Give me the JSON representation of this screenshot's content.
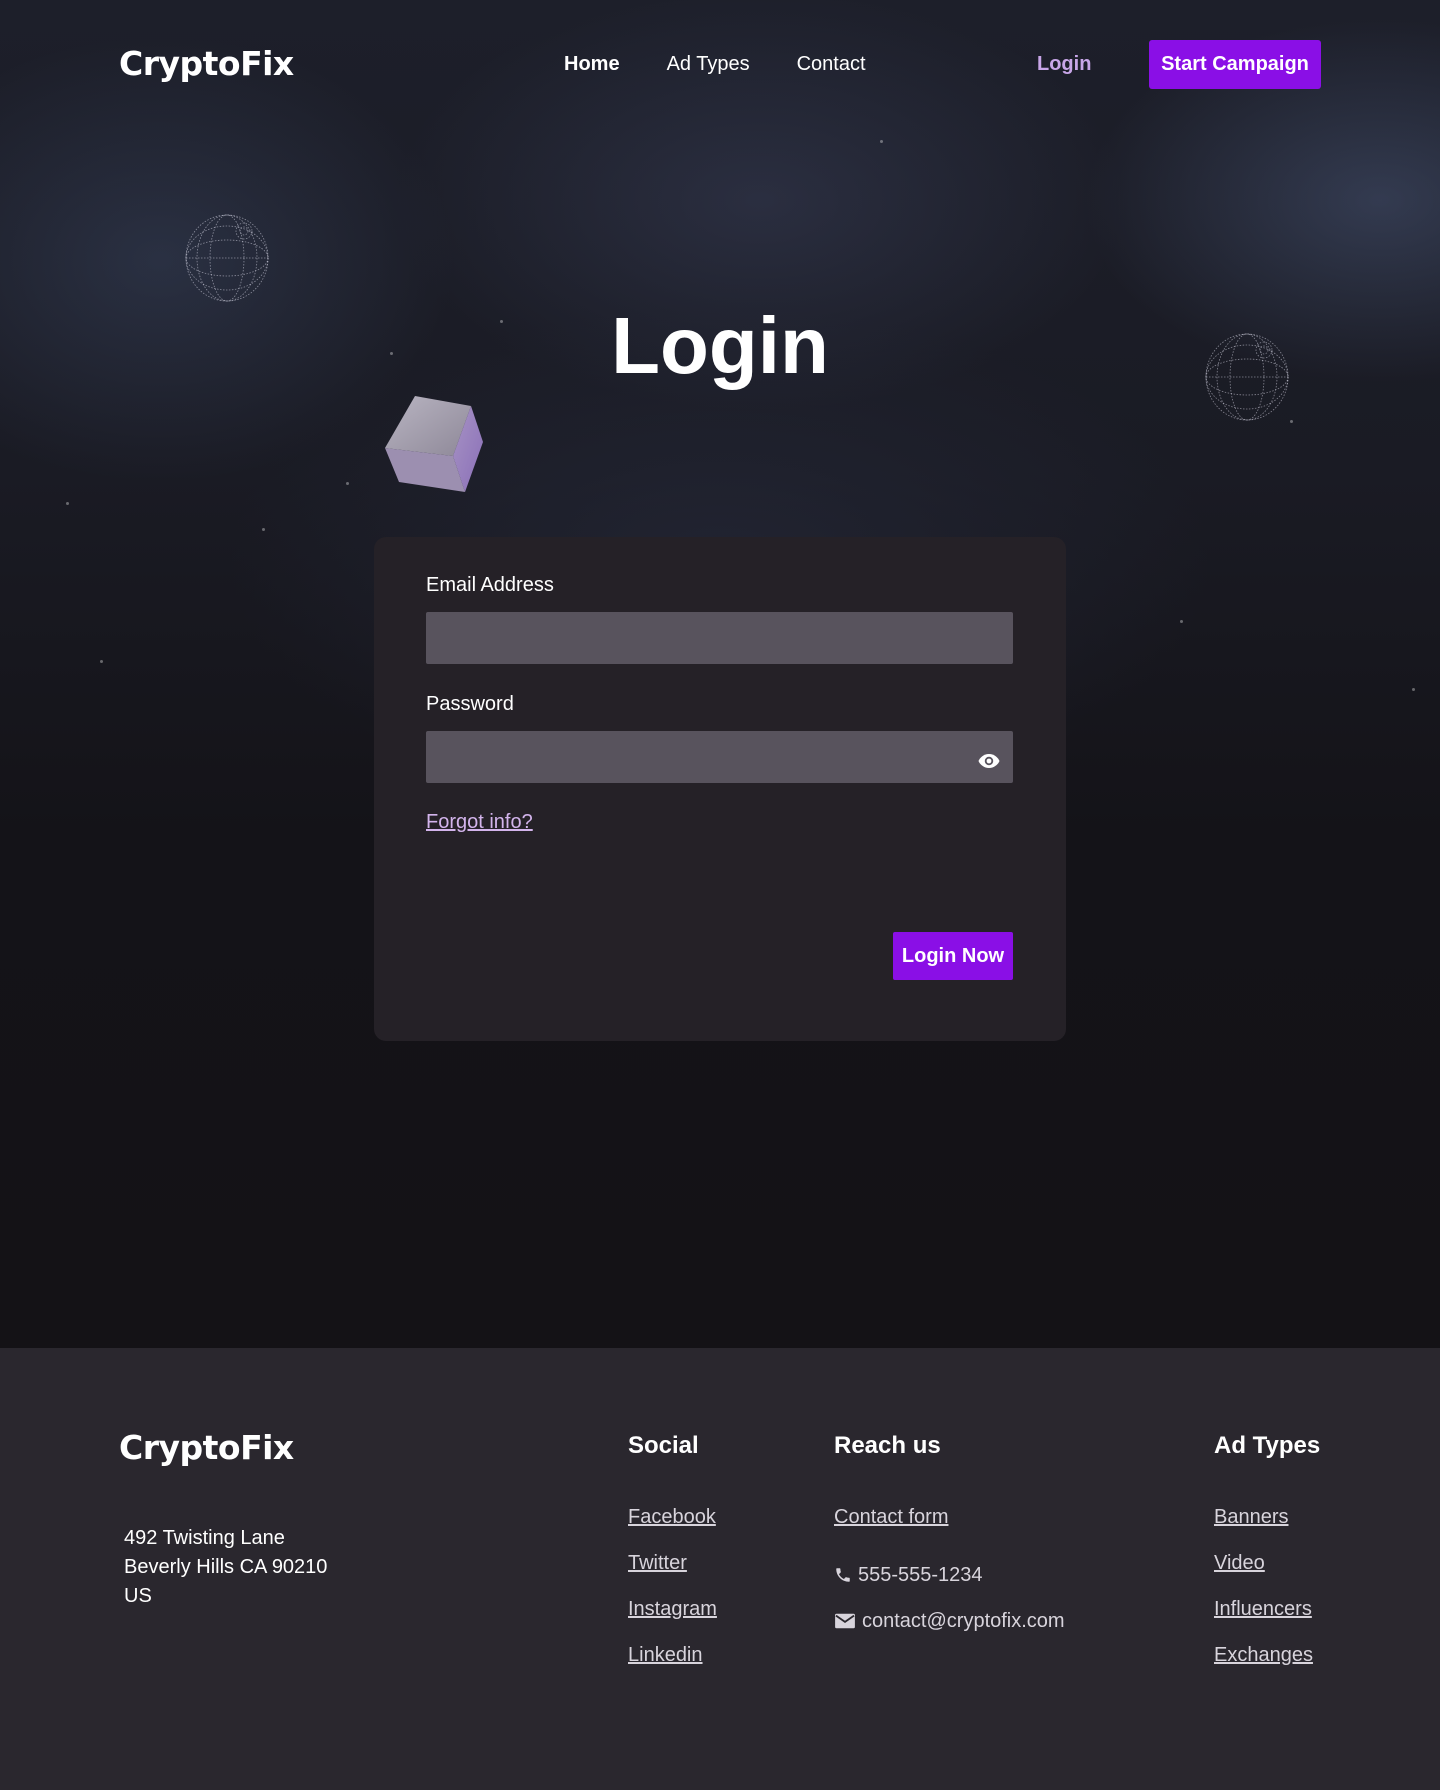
{
  "brand": {
    "name": "CryptoFix"
  },
  "nav": {
    "items": [
      {
        "label": "Home",
        "active": true
      },
      {
        "label": "Ad Types",
        "active": false
      },
      {
        "label": "Contact",
        "active": false
      }
    ],
    "login_label": "Login",
    "cta_label": "Start Campaign"
  },
  "page": {
    "title": "Login"
  },
  "form": {
    "email_label": "Email Address",
    "email_value": "",
    "password_label": "Password",
    "password_value": "",
    "forgot_label": "Forgot info?",
    "submit_label": "Login Now"
  },
  "footer": {
    "brand": "CryptoFix",
    "address": [
      "492 Twisting Lane",
      "Beverly Hills CA 90210",
      "US"
    ],
    "social": {
      "heading": "Social",
      "links": [
        "Facebook",
        "Twitter",
        "Instagram",
        "Linkedin"
      ]
    },
    "reach": {
      "heading": "Reach us",
      "contact_form": "Contact form",
      "phone": "555-555-1234",
      "email": "contact@cryptofix.com"
    },
    "ad_types": {
      "heading": "Ad Types",
      "links": [
        "Banners",
        "Video",
        "Influencers",
        "Exchanges"
      ]
    }
  },
  "colors": {
    "accent": "#8a0fe6",
    "link_lilac": "#c8a6e8",
    "card_bg": "#252127",
    "input_bg": "#58535d",
    "footer_bg": "#2a272e"
  },
  "icons": [
    "globe-wireframe-icon",
    "cube-icon",
    "eye-icon",
    "phone-icon",
    "mail-icon"
  ]
}
